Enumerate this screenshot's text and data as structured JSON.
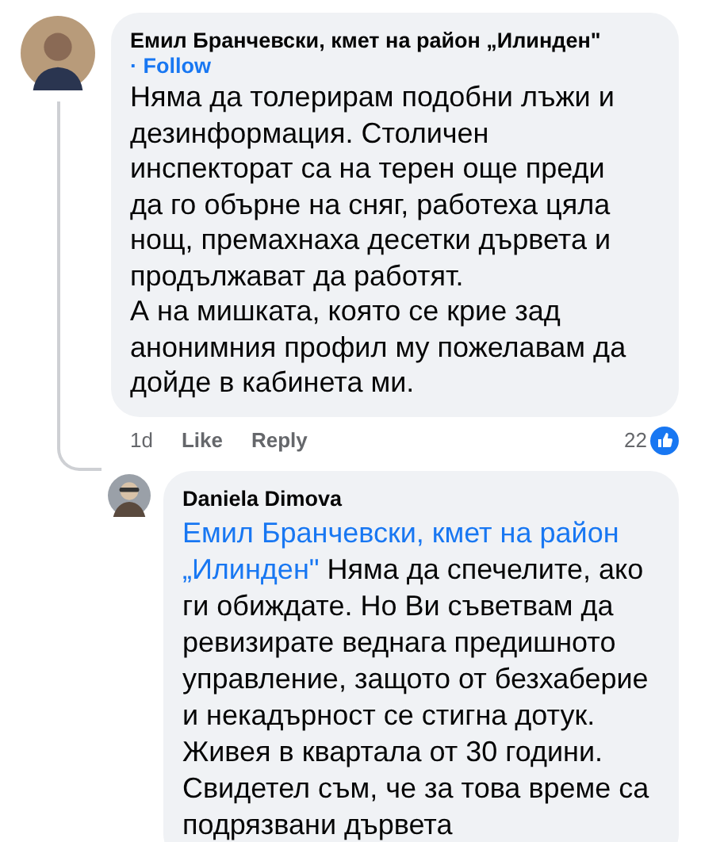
{
  "comment": {
    "author": "Емил Бранчевски, кмет на район „Илинден\"",
    "follow": "· Follow",
    "paragraphs": [
      "Няма да толерирам подобни лъжи и дезинформация. Столичен инспекторат са на терен още преди да го обърне на сняг, работеха цяла нощ, премахнаха десетки дървета и продължават да работят.",
      "А на мишката, която се крие зад анонимния профил му пожелавам да дойде в кабинета ми."
    ],
    "time": "1d",
    "actions": [
      "Like",
      "Reply"
    ],
    "reaction_count": "22"
  },
  "reply": {
    "author": "Daniela Dimova",
    "mention": "Емил Бранчевски, кмет на район „Илинден\"",
    "text": " Няма да спечелите, ако ги обиждате. Но Ви съветвам да ревизирате веднага предишното управление, защото от безхаберие и некадърност се стигна дотук. Живея в квартала от 30 години. Свидетел съм, че за това време са подрязвани дървета"
  }
}
